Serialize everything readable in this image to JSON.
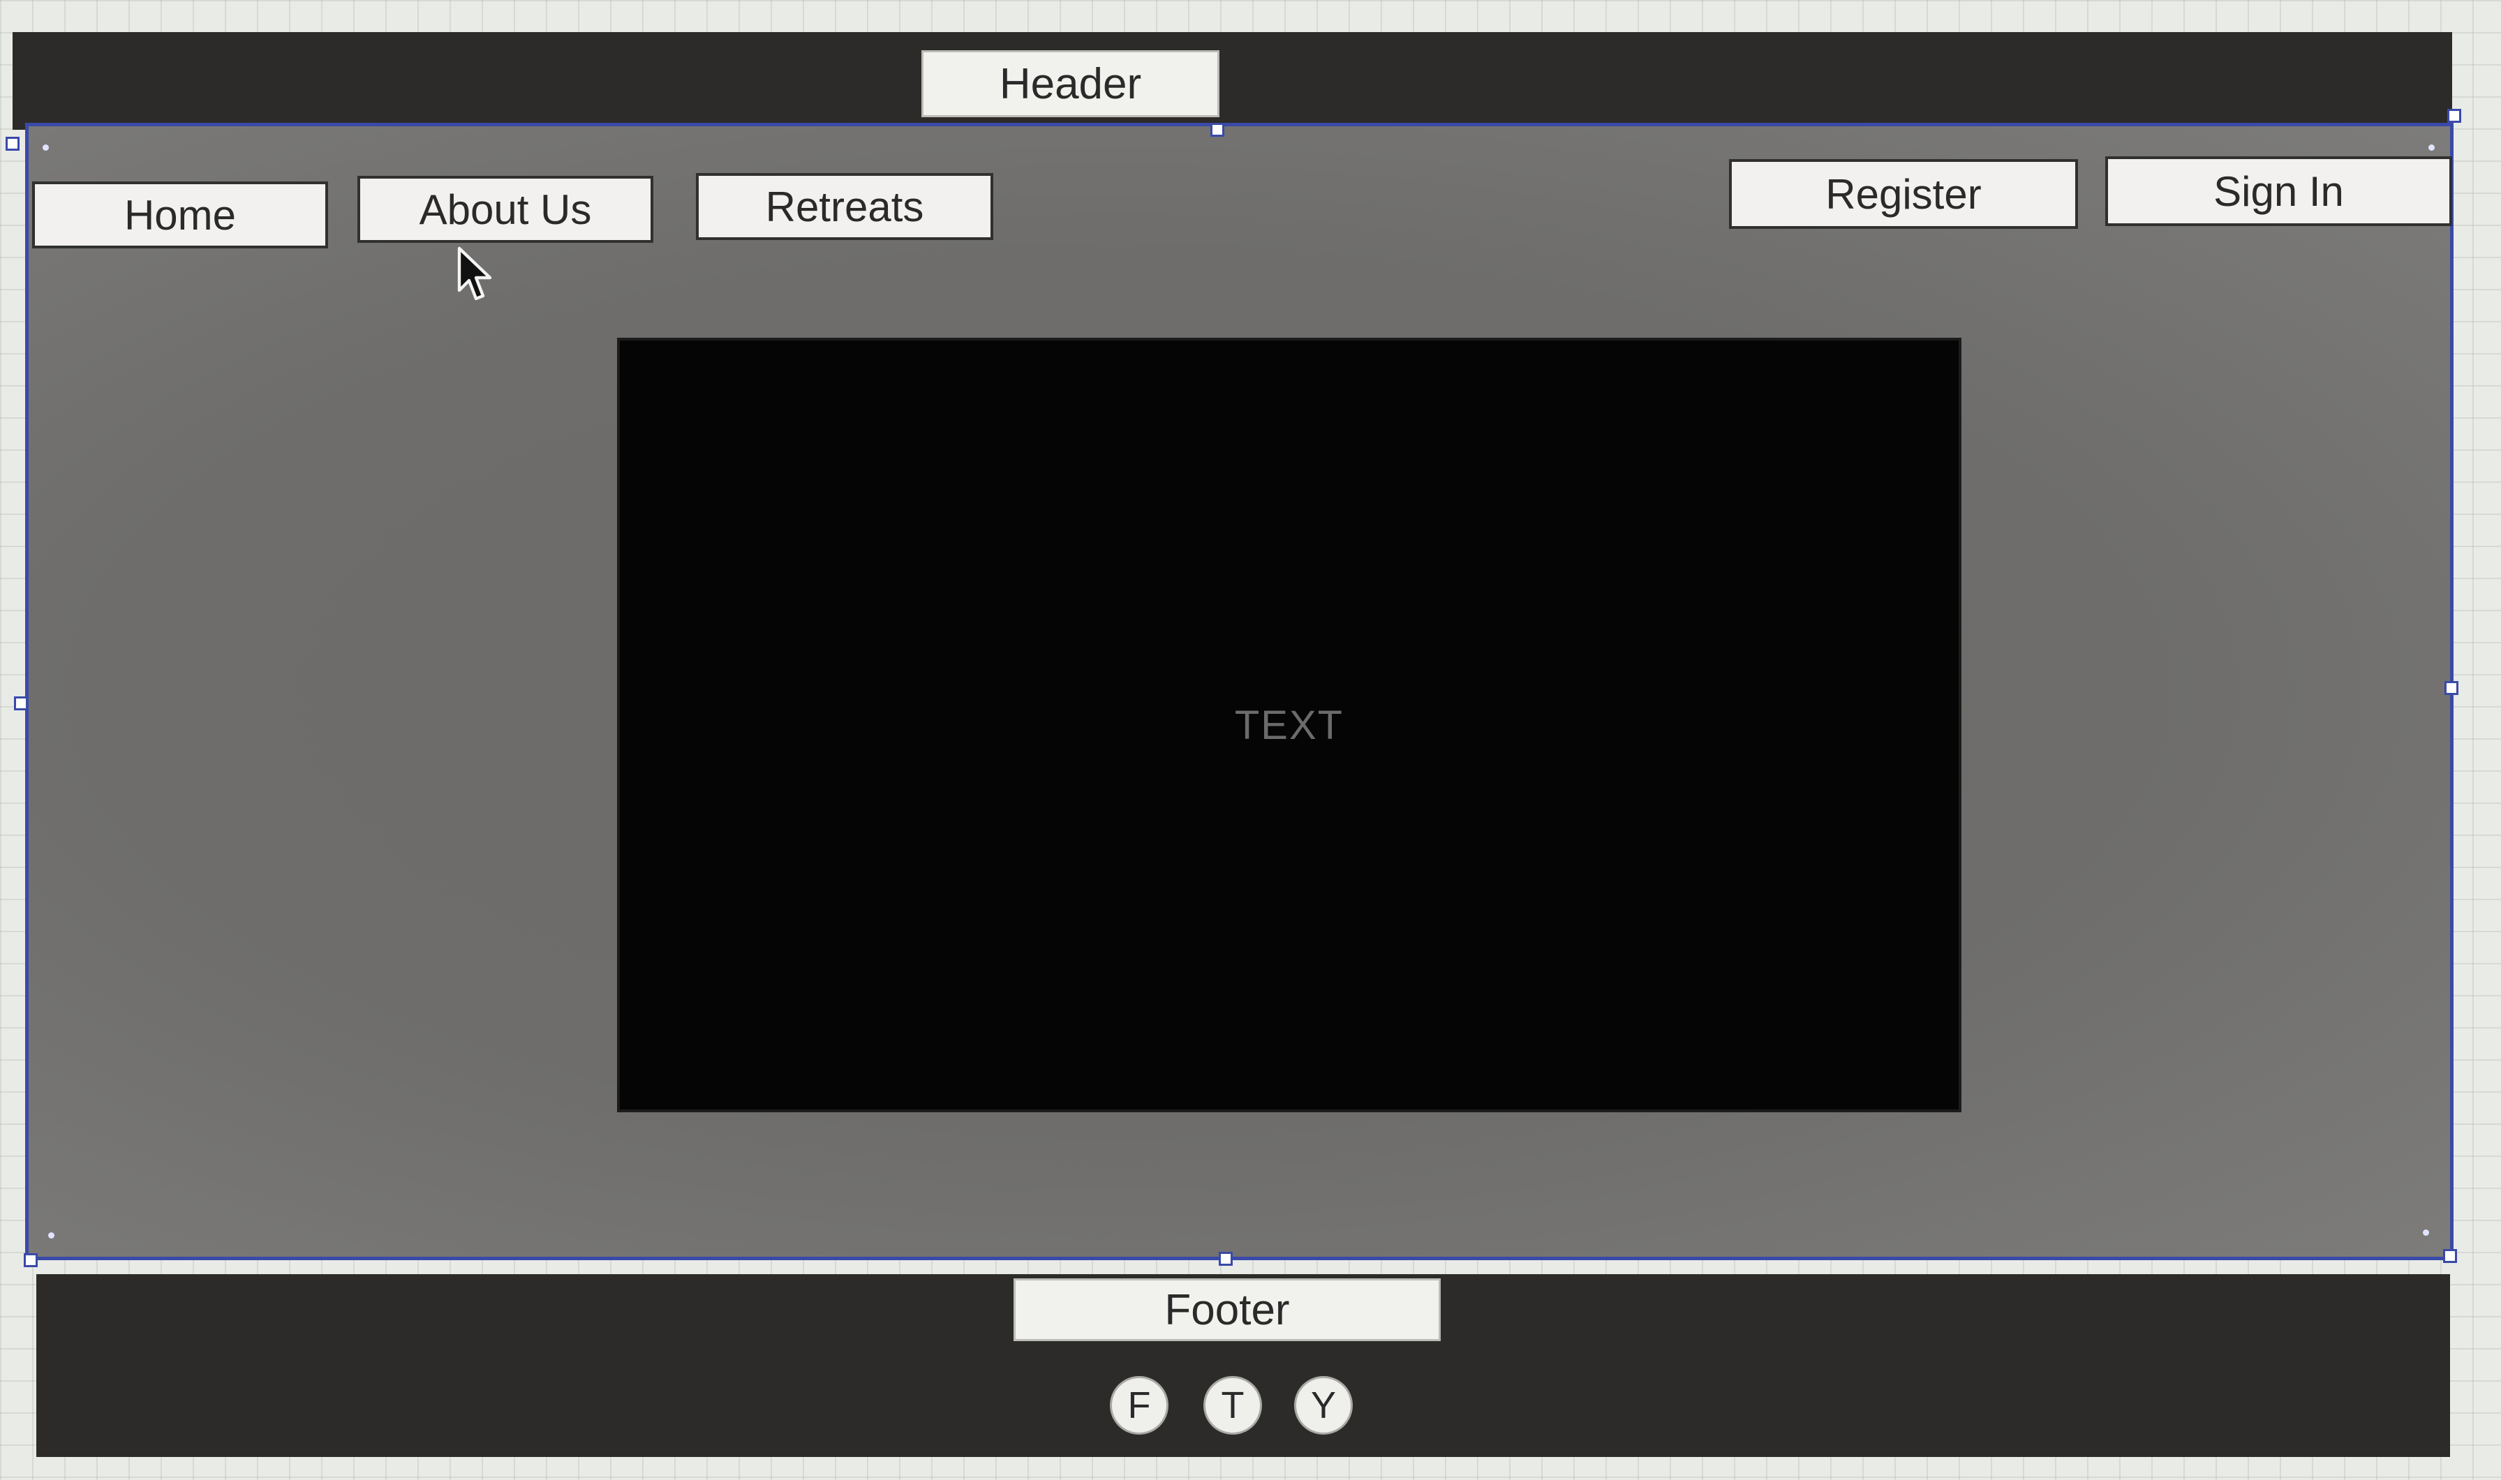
{
  "header": {
    "label": "Header"
  },
  "nav": {
    "home": "Home",
    "about": "About Us",
    "retreats": "Retreats",
    "register": "Register",
    "sign_in": "Sign In"
  },
  "hero": {
    "text": "TEXT"
  },
  "footer": {
    "label": "Footer",
    "social": [
      "F",
      "T",
      "Y"
    ]
  },
  "colors": {
    "bar": "#2d2b29",
    "selection": "#3a4aa8",
    "hero": "#050505"
  }
}
